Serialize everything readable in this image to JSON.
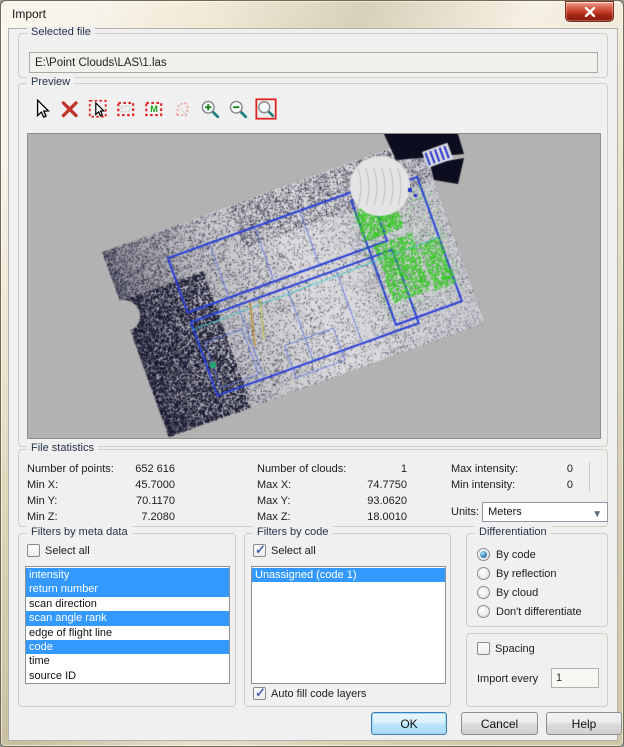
{
  "window": {
    "title": "Import",
    "close_icon": "close-x"
  },
  "selected_file": {
    "group_label": "Selected file",
    "path": "E:\\Point Clouds\\LAS\\1.las"
  },
  "preview": {
    "group_label": "Preview",
    "toolbar_icons": [
      "pointer",
      "delete-selection",
      "select-pointer",
      "rectangle-select",
      "select-by-meta",
      "polygon-select",
      "zoom-in",
      "zoom-out",
      "zoom-window"
    ],
    "colors": {
      "bg": "#b2b2b2",
      "dark": "#15152d",
      "mid": "#23233f",
      "speck": "#3a3a58",
      "line_blue": "#2c42d8",
      "line_blue2": "#5a74e2",
      "green": "#35cc22",
      "teal": "#3fc8c8",
      "dome": "#e4e4e4",
      "wedge": "#0d0d20",
      "orange": "#c08a2a",
      "yellow": "#cfcf3f"
    }
  },
  "file_statistics": {
    "group_label": "File statistics",
    "col1": [
      {
        "label": "Number of points:",
        "value": "652 616"
      },
      {
        "label": "Min X:",
        "value": "45.7000"
      },
      {
        "label": "Min Y:",
        "value": "70.1170"
      },
      {
        "label": "Min Z:",
        "value": "7.2080"
      }
    ],
    "col2": [
      {
        "label": "Number of clouds:",
        "value": "1"
      },
      {
        "label": "Max X:",
        "value": "74.7750"
      },
      {
        "label": "Max Y:",
        "value": "93.0620"
      },
      {
        "label": "Max Z:",
        "value": "18.0010"
      }
    ],
    "col3": [
      {
        "label": "Max intensity:",
        "value": "0"
      },
      {
        "label": "Min intensity:",
        "value": "0"
      }
    ],
    "units_label": "Units:",
    "units_value": "Meters"
  },
  "filters_meta": {
    "group_label": "Filters by meta data",
    "select_all": {
      "label": "Select all",
      "checked": false
    },
    "items": [
      {
        "label": "intensity",
        "selected": true
      },
      {
        "label": "return number",
        "selected": true
      },
      {
        "label": "scan direction",
        "selected": false
      },
      {
        "label": "scan angle rank",
        "selected": true
      },
      {
        "label": "edge of flight line",
        "selected": false
      },
      {
        "label": "code",
        "selected": true
      },
      {
        "label": "time",
        "selected": false
      },
      {
        "label": "source ID",
        "selected": false
      }
    ]
  },
  "filters_code": {
    "group_label": "Filters by code",
    "select_all": {
      "label": "Select all",
      "checked": true
    },
    "items": [
      {
        "label": "Unassigned (code 1)",
        "selected": true
      }
    ],
    "auto_fill": {
      "label": "Auto fill code layers",
      "checked": true
    }
  },
  "differentiation": {
    "group_label": "Differentiation",
    "options": [
      {
        "label": "By code",
        "selected": true
      },
      {
        "label": "By reflection",
        "selected": false
      },
      {
        "label": "By cloud",
        "selected": false
      },
      {
        "label": "Don't differentiate",
        "selected": false
      }
    ]
  },
  "spacing": {
    "checkbox_label": "Spacing",
    "checked": false,
    "import_every_label": "Import every",
    "import_every_value": "1"
  },
  "buttons": [
    {
      "label": "OK",
      "default": true
    },
    {
      "label": "Cancel",
      "default": false
    },
    {
      "label": "Help",
      "default": false
    }
  ]
}
